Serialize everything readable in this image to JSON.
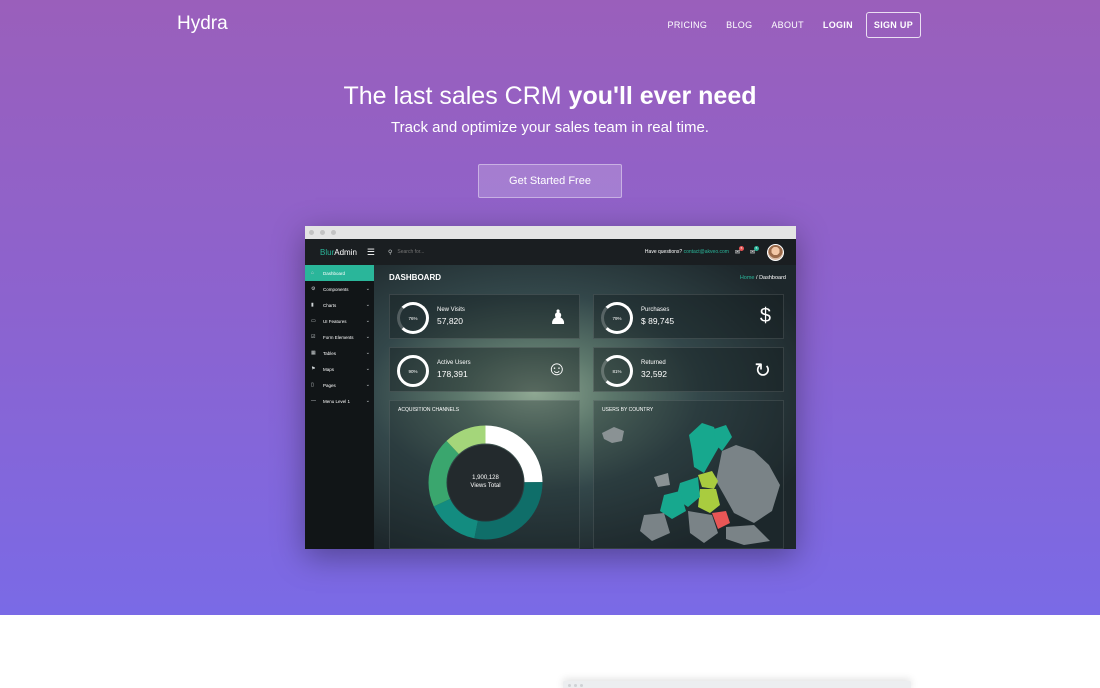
{
  "nav": {
    "brand": "Hydra",
    "links": [
      "PRICING",
      "BLOG",
      "ABOUT"
    ],
    "login": "LOGIN",
    "signup": "SIGN UP"
  },
  "hero": {
    "headline_light": "The last sales CRM",
    "headline_bold": "you'll ever need",
    "subheadline": "Track and optimize your sales team in real time.",
    "cta": "Get Started Free"
  },
  "colors": {
    "gradient_top": "#9a5fbb",
    "gradient_bottom": "#7a6ae6",
    "accent_green": "#2ab69a"
  },
  "screenshot": {
    "logo_part1": "Blur",
    "logo_part2": "Admin",
    "search_placeholder": "Search for...",
    "question_text": "Have questions?",
    "contact_email": "contact@akveo.com",
    "bell_badge": "5",
    "mail_badge": "5",
    "sidebar": [
      {
        "label": "Dashboard",
        "icon": "home-icon",
        "active": true
      },
      {
        "label": "Components",
        "icon": "gear-icon"
      },
      {
        "label": "Charts",
        "icon": "bar-chart-icon"
      },
      {
        "label": "UI Features",
        "icon": "monitor-icon"
      },
      {
        "label": "Form Elements",
        "icon": "form-icon"
      },
      {
        "label": "Tables",
        "icon": "table-icon"
      },
      {
        "label": "Maps",
        "icon": "map-icon"
      },
      {
        "label": "Pages",
        "icon": "page-icon"
      },
      {
        "label": "Menu Level 1",
        "icon": "menu-icon"
      }
    ],
    "dashboard_title": "DASHBOARD",
    "breadcrumb_home": "Home",
    "breadcrumb_current": "Dashboard",
    "cards": [
      {
        "label": "New Visits",
        "value": "57,820",
        "percent": "76%",
        "icon": "user-icon"
      },
      {
        "label": "Purchases",
        "value": "$ 89,745",
        "percent": "79%",
        "icon": "dollar-icon"
      },
      {
        "label": "Active Users",
        "value": "178,391",
        "percent": "90%",
        "icon": "smile-icon"
      },
      {
        "label": "Returned",
        "value": "32,592",
        "percent": "81%",
        "icon": "refresh-icon"
      }
    ],
    "acquisition_title": "ACQUISITION CHANNELS",
    "donut_value": "1,900,128",
    "donut_label": "Views Total",
    "country_title": "USERS BY COUNTRY"
  }
}
